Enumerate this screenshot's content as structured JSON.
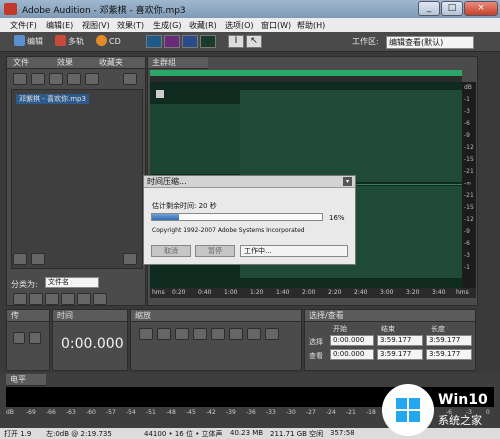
{
  "window": {
    "title": "Adobe Audition - 邓紫棋 - 喜欢你.mp3",
    "controls": [
      "_",
      "□",
      "×"
    ]
  },
  "menu": [
    "文件(F)",
    "编辑(E)",
    "视图(V)",
    "效果(T)",
    "生成(G)",
    "收藏(R)",
    "选项(O)",
    "窗口(W)",
    "帮助(H)"
  ],
  "toolbar": {
    "edit": "编辑",
    "multitrack": "多轨",
    "cd": "CD",
    "workspace_label": "工作区:",
    "workspace_value": "编辑查看(默认)"
  },
  "left_panel": {
    "tabs": [
      "文件",
      "效果",
      "收藏夹"
    ],
    "file_item": "邓紫棋 - 喜欢你.mp3",
    "sort_label": "分类为:",
    "sort_value": "文件名"
  },
  "main_panel": {
    "tab": "主群组",
    "db_labels": [
      "dB",
      "-1",
      "-3",
      "-6",
      "-9",
      "-12",
      "-15",
      "-21",
      "-∞",
      "-21",
      "-15",
      "-12",
      "-9",
      "-6",
      "-3",
      "-1"
    ],
    "time_labels": [
      "hms",
      "0:20",
      "0:40",
      "1:00",
      "1:20",
      "1:40",
      "2:00",
      "2:20",
      "2:40",
      "3:00",
      "3:20",
      "3:40",
      "hms"
    ]
  },
  "dialog": {
    "title": "时间压缩...",
    "remaining": "估计剩余时间: 20 秒",
    "percent": "16%",
    "progress": 0.16,
    "copyright": "Copyright 1992-2007 Adobe Systems Incorporated",
    "cancel": "取消",
    "pause": "暂停",
    "status": "工作中..."
  },
  "transport": {
    "tab": "传"
  },
  "time_panel": {
    "tab": "时间",
    "value": "0:00.000"
  },
  "zoom_panel": {
    "tab": "缩放"
  },
  "selection_panel": {
    "tab": "选择/查看",
    "headers": [
      "开始",
      "结束",
      "长度"
    ],
    "rows": [
      {
        "label": "选择",
        "start": "0:00.000",
        "end": "3:59.177",
        "length": "3:59.177"
      },
      {
        "label": "查看",
        "start": "0:00.000",
        "end": "3:59.177",
        "length": "3:59.177"
      }
    ]
  },
  "level_panel": {
    "tab": "电平",
    "scale": [
      "dB",
      "-69",
      "-66",
      "-63",
      "-60",
      "-57",
      "-54",
      "-51",
      "-48",
      "-45",
      "-42",
      "-39",
      "-36",
      "-33",
      "-30",
      "-27",
      "-24",
      "-21",
      "-18",
      "-15",
      "-12",
      "-9",
      "-6",
      "-3",
      "0"
    ]
  },
  "status": {
    "open": "打开 1.9",
    "peak": "左:0dB @ 2:19.735",
    "format": "44100 • 16 位 • 立体声",
    "size": "40.23 MB",
    "free": "211.71 GB 空闲",
    "time": "357:58"
  },
  "watermark": {
    "brand": "Win10",
    "sub": "系统之家"
  },
  "colors": {
    "wave": "#1f4a37",
    "accent": "#2e6eb5"
  }
}
